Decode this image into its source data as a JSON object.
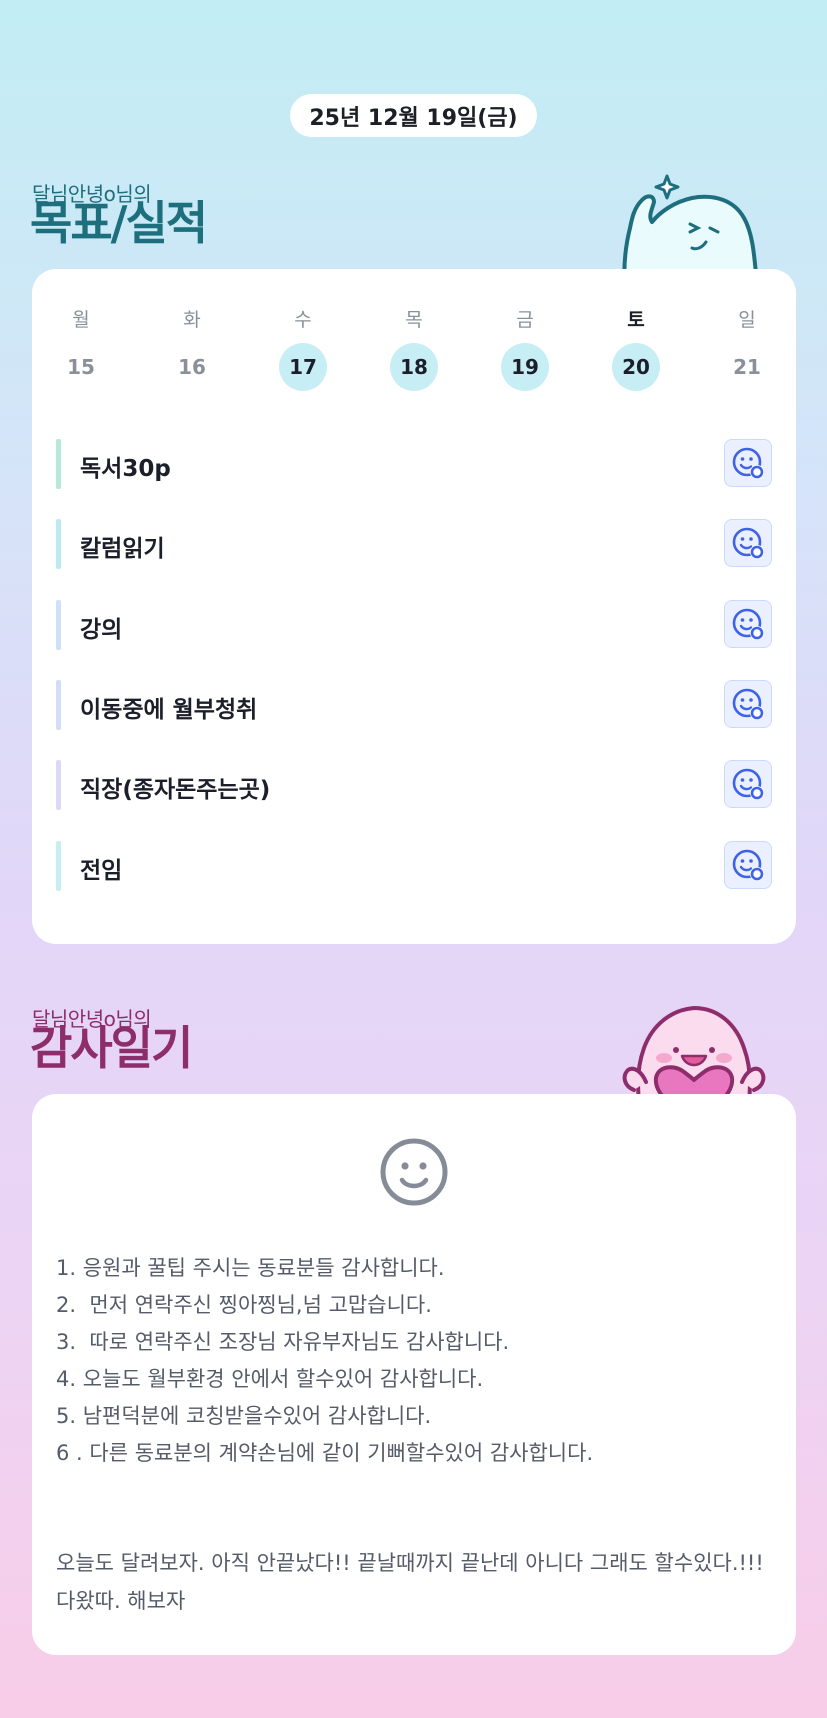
{
  "date": "25년 12월 19일(금)",
  "goals_section": {
    "subtitle": "달님안녕o님의",
    "title": "목표/실적"
  },
  "week": {
    "days": [
      {
        "name": "월",
        "num": "15",
        "active": false
      },
      {
        "name": "화",
        "num": "16",
        "active": false
      },
      {
        "name": "수",
        "num": "17",
        "active": true
      },
      {
        "name": "목",
        "num": "18",
        "active": true
      },
      {
        "name": "금",
        "num": "19",
        "active": true
      },
      {
        "name": "토",
        "num": "20",
        "active": true
      },
      {
        "name": "일",
        "num": "21",
        "active": false
      }
    ]
  },
  "goals": [
    {
      "text": "독서30p",
      "bar_color": "#b5ead8"
    },
    {
      "text": "칼럼읽기",
      "bar_color": "#bde9f0"
    },
    {
      "text": "강의",
      "bar_color": "#cfe0f7"
    },
    {
      "text": "이동중에 월부청취",
      "bar_color": "#d3ddf7"
    },
    {
      "text": "직장(종자돈주는곳)",
      "bar_color": "#dcd8f7"
    },
    {
      "text": "전임",
      "bar_color": "#c8edf3"
    }
  ],
  "goal_action_icon": "smile-add-icon",
  "gratitude_section": {
    "subtitle": "달님안녕o님의",
    "title": "감사일기",
    "mood_icon": "smile-face-icon",
    "lines": [
      "1. 응원과 꿀팁 주시는 동료분들 감사합니다.",
      "2.  먼저 연락주신 찡아찡님,넘 고맙습니다.",
      "3.  따로 연락주신 조장님 자유부자님도 감사합니다.",
      "4. 오늘도 월부환경 안에서 할수있어 감사합니다.",
      "5. 남편덕분에 코칭받을수있어 감사합니다.",
      "6 . 다른 동료분의 계약손님에 같이 기뻐할수있어 감사합니다."
    ],
    "closing": "오늘도 달려보자. 아직 안끝났다!!  끝날때까지 끝난데 아니다 그래도 할수있다.!!! 다왔따. 해보자"
  },
  "colors": {
    "goal_title": "#1e6f7d",
    "gratitude_title": "#8e2d6c",
    "active_day": "#c7eef4",
    "icon_blue": "#3f63e6"
  }
}
